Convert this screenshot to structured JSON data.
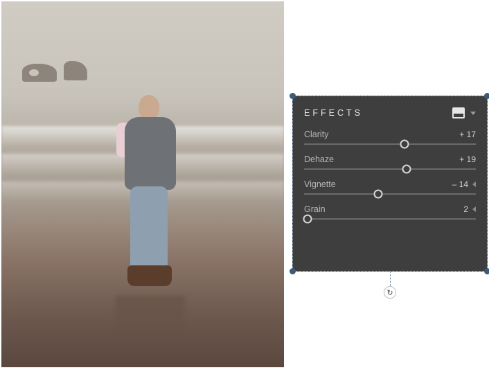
{
  "panel": {
    "title": "EFFECTS",
    "sliders": [
      {
        "label": "Clarity",
        "display": "+ 17",
        "value": 17,
        "min": -100,
        "max": 100,
        "expandable": false
      },
      {
        "label": "Dehaze",
        "display": "+ 19",
        "value": 19,
        "min": -100,
        "max": 100,
        "expandable": false
      },
      {
        "label": "Vignette",
        "display": "– 14",
        "value": -14,
        "min": -100,
        "max": 100,
        "expandable": true
      },
      {
        "label": "Grain",
        "display": "2",
        "value": 2,
        "min": 0,
        "max": 100,
        "expandable": true
      }
    ]
  }
}
